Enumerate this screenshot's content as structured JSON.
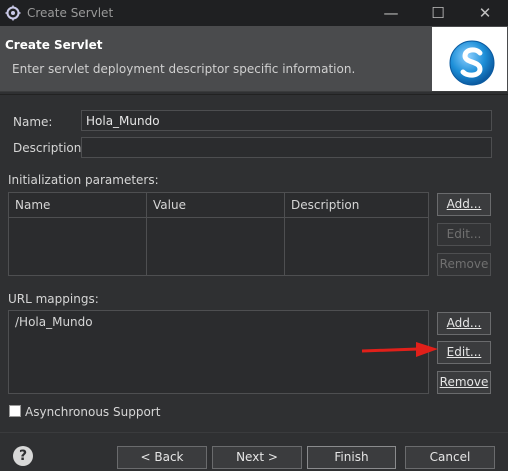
{
  "window": {
    "title": "Create Servlet"
  },
  "banner": {
    "title": "Create Servlet",
    "description": "Enter servlet deployment descriptor specific information."
  },
  "form": {
    "name_label": "Name:",
    "name_value": "Hola_Mundo",
    "description_label": "Description:",
    "description_value": ""
  },
  "init_params": {
    "label": "Initialization parameters:",
    "columns": [
      "Name",
      "Value",
      "Description"
    ],
    "buttons": {
      "add": "Add...",
      "edit": "Edit...",
      "remove": "Remove"
    }
  },
  "url_mappings": {
    "label": "URL mappings:",
    "items": [
      "/Hola_Mundo"
    ],
    "buttons": {
      "add": "Add...",
      "edit": "Edit...",
      "remove": "Remove"
    }
  },
  "async": {
    "label": "Asynchronous Support",
    "checked": false
  },
  "footer": {
    "back": "< Back",
    "next": "Next >",
    "finish": "Finish",
    "cancel": "Cancel"
  },
  "colors": {
    "annotation_arrow": "#e0201a",
    "logo_blue": "#1d8fd8"
  }
}
